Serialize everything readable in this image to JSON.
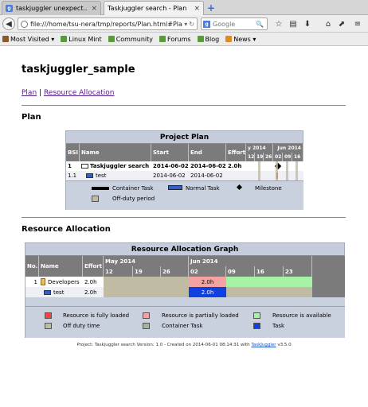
{
  "browser": {
    "tabs": [
      {
        "label": "taskjuggler unexpect...",
        "favicon": "g"
      },
      {
        "label": "Taskjuggler search - Plan",
        "favicon": ""
      }
    ],
    "url": "file:///home/tsu-nera/tmp/reports/Plan.html#Plan",
    "search_placeholder": "Google",
    "bookmarks": [
      "Most Visited",
      "Linux Mint",
      "Community",
      "Forums",
      "Blog",
      "News"
    ]
  },
  "page": {
    "title": "taskjuggler_sample",
    "nav_links": [
      "Plan",
      "Resource Allocation"
    ],
    "nav_sep": "|",
    "plan_heading": "Plan",
    "resource_heading": "Resource Allocation",
    "footer": {
      "text": "Project: Taskjuggler search Version: 1.0 - Created on 2014-06-01 08:14:31 with",
      "link": "TaskJuggler",
      "version": "v3.5.0"
    }
  },
  "project_plan": {
    "title": "Project Plan",
    "columns": [
      "BSI",
      "Name",
      "Start",
      "End",
      "Effort"
    ],
    "months": [
      "y 2014",
      "Jun 2014"
    ],
    "days": [
      "12",
      "19",
      "26",
      "02",
      "09",
      "16"
    ],
    "rows": [
      {
        "bsi": "1",
        "name": "Taskjuggler search",
        "start": "2014-06-02",
        "end": "2014-06-02",
        "effort": "2.0h",
        "bold": true
      },
      {
        "bsi": "1.1",
        "name": "test",
        "start": "2014-06-02",
        "end": "2014-06-02",
        "effort": "",
        "bold": false
      }
    ],
    "legend": {
      "container": "Container Task",
      "normal": "Normal Task",
      "milestone": "Milestone",
      "offduty": "Off-duty period"
    }
  },
  "resource_graph": {
    "title": "Resource Allocation Graph",
    "columns": [
      "No.",
      "Name",
      "Effort"
    ],
    "months": [
      "May 2014",
      "Jun 2014"
    ],
    "days": [
      "12",
      "19",
      "26",
      "02",
      "09",
      "16",
      "23"
    ],
    "rows": [
      {
        "no": "1",
        "name": "Developers",
        "effort": "2.0h",
        "cell_value": "2.0h"
      },
      {
        "no": "",
        "name": "test",
        "effort": "2.0h",
        "cell_value": "2.0h"
      }
    ],
    "legend": {
      "fully": "Resource is fully loaded",
      "partially": "Resource is partially loaded",
      "available": "Resource is available",
      "offduty": "Off duty time",
      "container": "Container Task",
      "task": "Task"
    },
    "colors": {
      "fully": "#ff4040",
      "partially": "#f7a2a2",
      "available": "#a6f2a6",
      "offduty": "#c0bca4",
      "container": "#a4b4a4",
      "task": "#1040e0"
    }
  }
}
